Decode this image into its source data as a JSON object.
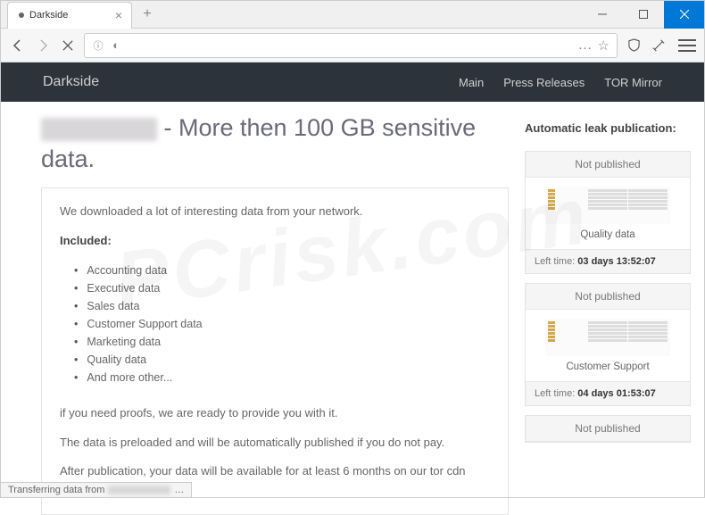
{
  "window": {
    "tab_title": "Darkside",
    "min": "—",
    "max": "☐",
    "close": "✕"
  },
  "toolbar": {
    "url_dots": "…",
    "star": "☆"
  },
  "site": {
    "title": "Darkside",
    "nav": [
      "Main",
      "Press Releases",
      "TOR Mirror"
    ]
  },
  "page": {
    "title_suffix": " - More then 100 GB sensitive data.",
    "intro": "We downloaded a lot of interesting data from your network.",
    "included_label": "Included:",
    "items": [
      "Accounting data",
      "Executive data",
      "Sales data",
      "Customer Support data",
      "Marketing data",
      "Quality data",
      "And more other..."
    ],
    "proof": "if you need proofs, we are ready to provide you with it.",
    "preload": "The data is preloaded and will be automatically published if you do not pay.",
    "after": "After publication, your data will be available for at least 6 months on our tor cdn servers."
  },
  "sidebar": {
    "title": "Automatic leak publication:",
    "cards": [
      {
        "head": "Not published",
        "label": "Quality data",
        "foot_prefix": "Left time: ",
        "foot_time": "03 days 13:52:07"
      },
      {
        "head": "Not published",
        "label": "Customer Support",
        "foot_prefix": "Left time: ",
        "foot_time": "04 days 01:53:07"
      },
      {
        "head": "Not published",
        "label": "",
        "foot_prefix": "",
        "foot_time": ""
      }
    ]
  },
  "status": {
    "prefix": "Transferring data from ",
    "suffix": "…"
  }
}
